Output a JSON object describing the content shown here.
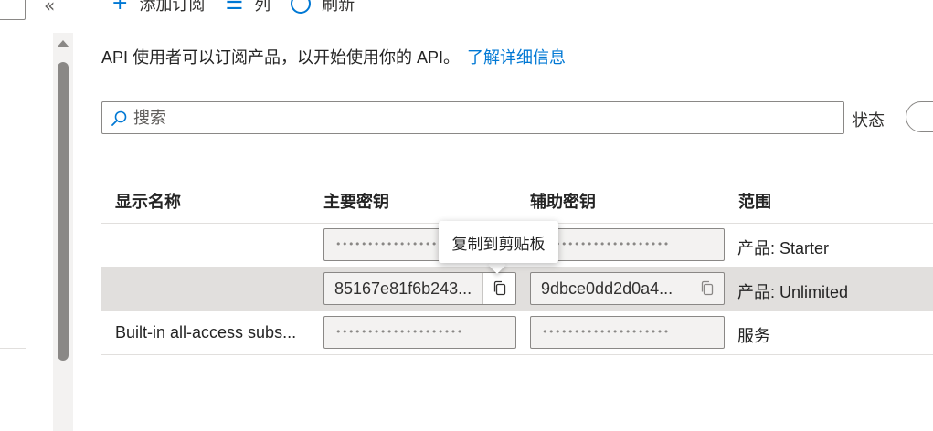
{
  "nav": {
    "collapse_glyph": "«"
  },
  "toolbar": {
    "add_label": "添加订阅",
    "columns_label": "列",
    "refresh_label": "刷新"
  },
  "description": {
    "text": "API 使用者可以订阅产品，以开始使用你的 API。",
    "link": "了解详细信息"
  },
  "search": {
    "placeholder": "搜索"
  },
  "filter": {
    "status_label": "状态"
  },
  "table": {
    "headers": {
      "name": "显示名称",
      "primary": "主要密钥",
      "secondary": "辅助密钥",
      "scope": "范围"
    },
    "rows": [
      {
        "name": "",
        "primary": "••••••••••••••••••••",
        "secondary": "••••••••••••••••••••",
        "scope": "产品: Starter"
      },
      {
        "name": "",
        "primary": "85167e81f6b243...",
        "secondary": "9dbce0dd2d0a4...",
        "scope": "产品: Unlimited"
      },
      {
        "name": "Built-in all-access subs...",
        "primary": "••••••••••••••••••••",
        "secondary": "••••••••••••••••••••",
        "scope": "服务"
      }
    ]
  },
  "tooltip": {
    "text": "复制到剪贴板"
  },
  "colors": {
    "accent": "#0078d4",
    "selected_row": "#e1dfdd",
    "border": "#8a8886"
  }
}
